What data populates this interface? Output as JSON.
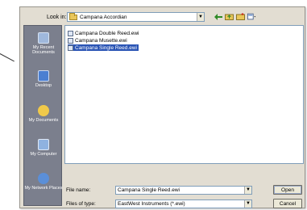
{
  "dialog": {
    "look_in_label": "Look in:",
    "current_folder": "Campana Accordian"
  },
  "places": [
    {
      "label": "My Recent Documents",
      "icon": "recent-documents-icon",
      "color": "#9fb8dc"
    },
    {
      "label": "Desktop",
      "icon": "desktop-icon",
      "color": "#4b7fd1"
    },
    {
      "label": "My Documents",
      "icon": "my-documents-icon",
      "color": "#f0c94a"
    },
    {
      "label": "My Computer",
      "icon": "my-computer-icon",
      "color": "#8fb2e0"
    },
    {
      "label": "My Network Places",
      "icon": "network-places-icon",
      "color": "#5b8fd8"
    }
  ],
  "files": [
    {
      "name": "Campana Double Reed.ewi",
      "selected": false
    },
    {
      "name": "Campana Musette.ewi",
      "selected": false
    },
    {
      "name": "Campana Single Reed.ewi",
      "selected": true
    }
  ],
  "form": {
    "file_name_label": "File name:",
    "file_name_value": "Campana Single Reed.ewi",
    "file_type_label": "Files of type:",
    "file_type_value": "EastWest Instruments (*.ewi)"
  },
  "buttons": {
    "open": "Open",
    "cancel": "Cancel"
  },
  "colors": {
    "selection": "#2b55b5",
    "places_bar": "#7b7f8d",
    "dialog_bg": "#e2ddd2"
  }
}
